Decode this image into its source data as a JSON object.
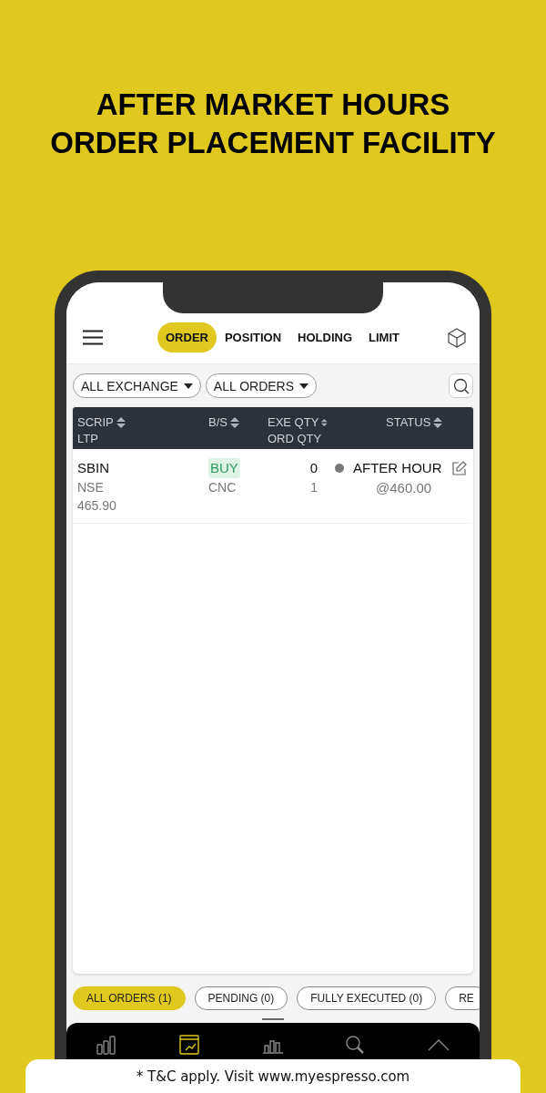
{
  "headline": [
    "AFTER MARKET HOURS",
    "ORDER PLACEMENT FACILITY"
  ],
  "tabs": [
    {
      "label": "ORDER",
      "selected": true
    },
    {
      "label": "POSITION",
      "selected": false
    },
    {
      "label": "HOLDING",
      "selected": false
    },
    {
      "label": "LIMIT",
      "selected": false
    }
  ],
  "filters": [
    "ALL EXCHANGE",
    "ALL ORDERS"
  ],
  "table": {
    "columns": [
      {
        "label": "SCRIP",
        "sub": "LTP"
      },
      {
        "label": "B/S"
      },
      {
        "label": "EXE QTY",
        "sub": "ORD QTY"
      },
      {
        "label": "STATUS"
      }
    ],
    "rows": [
      {
        "scrip": "SBIN",
        "exchange": "NSE",
        "ltp": "465.90",
        "side": "BUY",
        "product": "CNC",
        "exe_qty": "0",
        "ord_qty": "1",
        "status": "AFTER HOUR",
        "price": "@460.00"
      }
    ]
  },
  "chips": [
    {
      "label": "ALL ORDERS (1)",
      "selected": true
    },
    {
      "label": "PENDING (0)",
      "selected": false
    },
    {
      "label": "FULLY EXECUTED (0)",
      "selected": false
    },
    {
      "label": "RE",
      "selected": false
    }
  ],
  "nav": [
    {
      "kind": "watchlist",
      "selected": false
    },
    {
      "kind": "order",
      "selected": true
    },
    {
      "kind": "position",
      "selected": false
    },
    {
      "kind": "search",
      "selected": false
    },
    {
      "kind": "more",
      "selected": false
    }
  ],
  "footer": "* T&C apply. Visit www.myespresso.com"
}
